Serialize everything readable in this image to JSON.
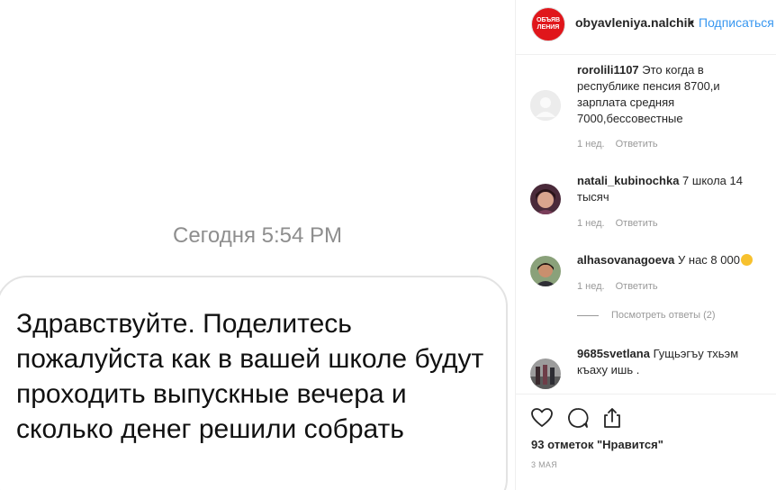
{
  "post_image": {
    "timestamp": "Сегодня 5:54 PM",
    "message": "Здравствуйте. Поделитесь пожалуйста как в вашей школе будут проходить выпускные вечера и сколько денег решили собрать"
  },
  "header": {
    "username": "obyavleniya.nalchik",
    "separator": "•",
    "follow_label": "Подписаться",
    "logo_text": [
      "ОБЪЯВ",
      "ЛЕНИЯ"
    ]
  },
  "comments": [
    {
      "username": "rorolili1107",
      "text": "Это когда в республике пенсия 8700,и зарплата средняя 7000,бессовестные",
      "time": "1 нед.",
      "reply": "Ответить"
    },
    {
      "username": "natali_kubinochka",
      "text": "7 школа 14 тысяч",
      "time": "1 нед.",
      "reply": "Ответить"
    },
    {
      "username": "alhasovanagoeva",
      "text": "У нас 8 000",
      "time": "1 нед.",
      "reply": "Ответить"
    },
    {
      "username": "9685svetlana",
      "text": "Гущьэгъу тхьэм къаху ишь .",
      "time": "",
      "reply": ""
    }
  ],
  "view_replies": "Посмотреть ответы (2)",
  "actions": {
    "likes": "93 отметок \"Нравится\"",
    "date": "3 МАЯ"
  }
}
